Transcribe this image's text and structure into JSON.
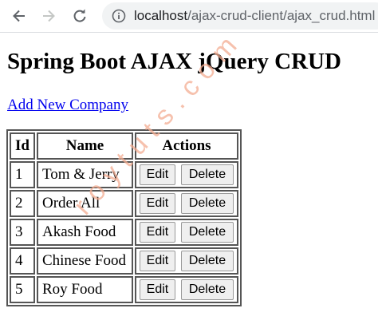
{
  "browser": {
    "url_host": "localhost",
    "url_path": "/ajax-crud-client/ajax_crud.html",
    "icons": {
      "back": "arrow-back-icon",
      "forward": "arrow-forward-icon",
      "reload": "reload-icon",
      "info": "info-icon"
    }
  },
  "page": {
    "title": "Spring Boot AJAX jQuery CRUD",
    "add_link": "Add New Company"
  },
  "table": {
    "headers": {
      "id": "Id",
      "name": "Name",
      "actions": "Actions"
    },
    "edit_label": "Edit",
    "delete_label": "Delete",
    "rows": [
      {
        "id": "1",
        "name": "Tom & Jerry"
      },
      {
        "id": "2",
        "name": "Order All"
      },
      {
        "id": "3",
        "name": "Akash Food"
      },
      {
        "id": "4",
        "name": "Chinese Food"
      },
      {
        "id": "5",
        "name": "Roy Food"
      }
    ]
  },
  "watermark": {
    "text": "roytuts.com",
    "color": "#f4ad92"
  }
}
